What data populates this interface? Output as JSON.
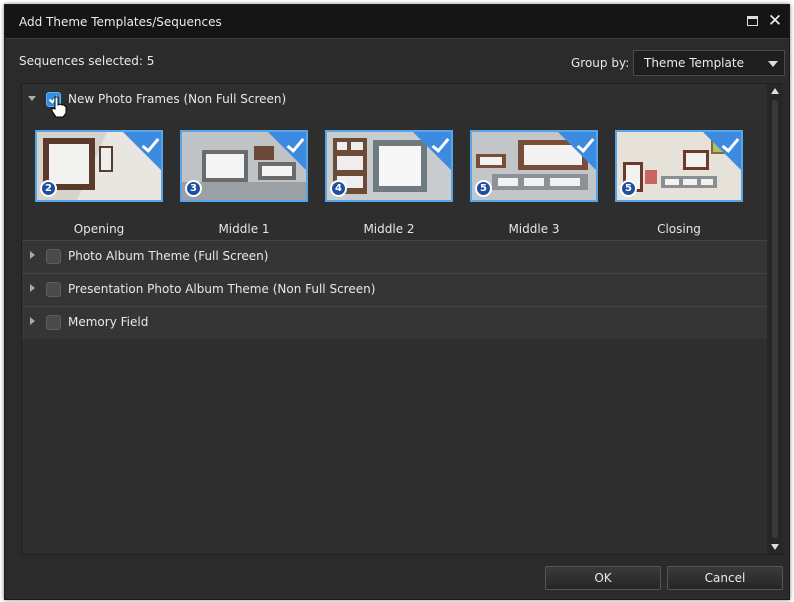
{
  "window": {
    "title": "Add Theme Templates/Sequences"
  },
  "toolbar": {
    "selected_text": "Sequences selected: 5",
    "group_by_label": "Group by:",
    "group_by_value": "Theme Template"
  },
  "groups": [
    {
      "label": "New Photo Frames (Non Full Screen)",
      "checked": true,
      "expanded": true,
      "templates": [
        {
          "label": "Opening",
          "badge": "2",
          "checked": true
        },
        {
          "label": "Middle 1",
          "badge": "3",
          "checked": true
        },
        {
          "label": "Middle 2",
          "badge": "4",
          "checked": true
        },
        {
          "label": "Middle 3",
          "badge": "5",
          "checked": true
        },
        {
          "label": "Closing",
          "badge": "5",
          "checked": true
        }
      ]
    },
    {
      "label": "Photo Album Theme (Full Screen)",
      "checked": false,
      "expanded": false
    },
    {
      "label": "Presentation Photo Album Theme (Non Full Screen)",
      "checked": false,
      "expanded": false
    },
    {
      "label": "Memory Field",
      "checked": false,
      "expanded": false
    }
  ],
  "buttons": {
    "ok": "OK",
    "cancel": "Cancel"
  },
  "colors": {
    "accent": "#2f8fe0",
    "badge": "#1f4fa0",
    "background": "#2b2b2b",
    "titlebar": "#151515"
  }
}
